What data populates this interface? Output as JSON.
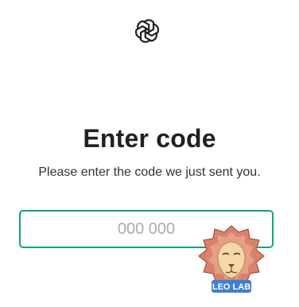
{
  "brand": {
    "logo_icon": "openai-logo-icon"
  },
  "heading": {
    "title": "Enter code",
    "subtitle": "Please enter the code we just sent you."
  },
  "code_field": {
    "value": "",
    "placeholder": "000 000",
    "border_color": "#10a37f"
  },
  "watermark": {
    "icon": "lion-head-icon",
    "text": "LEO LAB"
  }
}
